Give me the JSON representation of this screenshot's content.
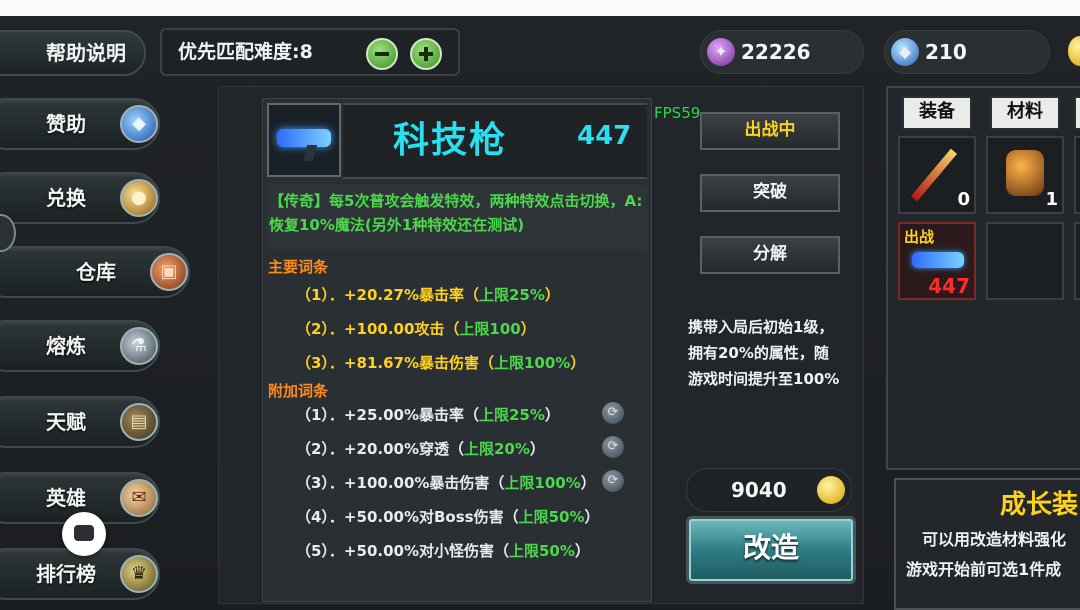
{
  "top_bar": {
    "help_label": "帮助说明",
    "difficulty_label": "优先匹配难度:8",
    "minus_icon": "minus-icon",
    "plus_icon": "plus-icon"
  },
  "resources": {
    "crystal_value": "22226",
    "gem_value": "210"
  },
  "sidebar": {
    "items": [
      {
        "label": "赞助",
        "icon": "gem-icon"
      },
      {
        "label": "兑换",
        "icon": "coins-icon"
      },
      {
        "label": "仓库",
        "icon": "chest-icon"
      },
      {
        "label": "熔炼",
        "icon": "furnace-icon"
      },
      {
        "label": "天赋",
        "icon": "book-icon"
      },
      {
        "label": "英雄",
        "icon": "scroll-icon"
      },
      {
        "label": "排行榜",
        "icon": "trophy-icon"
      }
    ]
  },
  "item": {
    "name": "科技枪",
    "power": "447",
    "description": "【传奇】每5次普攻会触发特效，两种特效点击切换，A:恢复10%魔法(另外1种特效还在测试)",
    "main_title": "主要词条",
    "main_stats": [
      {
        "text": "（1）．+20.27%暴击率（",
        "limit": "上限25%",
        "end": "）"
      },
      {
        "text": "（2）．+100.00攻击（",
        "limit": "上限100",
        "end": "）"
      },
      {
        "text": "（3）．+81.67%暴击伤害（",
        "limit": "上限100%",
        "end": "）"
      }
    ],
    "extra_title": "附加词条",
    "extra_stats": [
      {
        "text": "（1）．+25.00%暴击率（",
        "limit": "上限25%",
        "end": "）"
      },
      {
        "text": "（2）．+20.00%穿透（",
        "limit": "上限20%",
        "end": "）"
      },
      {
        "text": "（3）．+100.00%暴击伤害（",
        "limit": "上限100%",
        "end": "）"
      },
      {
        "text": "（4）．+50.00%对Boss伤害（",
        "limit": "上限50%",
        "end": "）"
      },
      {
        "text": "（5）．+50.00%对小怪伤害（",
        "limit": "上限50%",
        "end": "）"
      }
    ]
  },
  "actions": {
    "fps": "FPS59",
    "deploy_label": "出战中",
    "breakthrough_label": "突破",
    "decompose_label": "分解",
    "info_text_1": "携带入局后初始1级，",
    "info_text_2": "拥有20%的属性，随",
    "info_text_3": "游戏时间提升至100%",
    "cost_value": "9040",
    "modify_label": "改造"
  },
  "inventory": {
    "tab_equip": "装备",
    "tab_material": "材料",
    "slot1_count": "0",
    "slot2_count": "1",
    "slot_deploy_tag": "出战",
    "slot_deploy_power": "447"
  },
  "growth": {
    "title": "成长装",
    "line1": "可以用改造材料强化",
    "line2": "游戏开始前可选1件成"
  },
  "colors": {
    "cyan_title": "#28e0f0",
    "green_text": "#4cd84c",
    "orange_title": "#ff8c1a",
    "yellow_text": "#ffd21e",
    "red_power": "#ff2a2a",
    "fps_green": "#22dd44"
  }
}
